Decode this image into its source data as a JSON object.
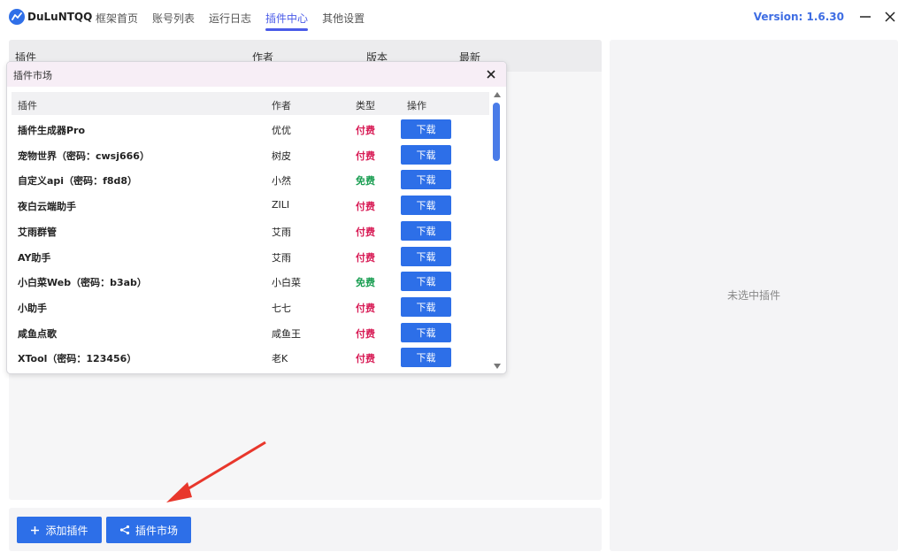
{
  "colors": {
    "accent": "#2d6fe8",
    "active_tab": "#4a5be8",
    "paid": "#d81b55",
    "free": "#1a9e52",
    "annotation_arrow": "#e8372c"
  },
  "app": {
    "name": "DuLuNTQQ",
    "version": "Version: 1.6.30"
  },
  "nav": {
    "tabs": [
      {
        "label": "框架首页",
        "active": false
      },
      {
        "label": "账号列表",
        "active": false
      },
      {
        "label": "运行日志",
        "active": false
      },
      {
        "label": "插件中心",
        "active": true
      },
      {
        "label": "其他设置",
        "active": false
      }
    ]
  },
  "plugin_table": {
    "headers": {
      "plugin": "插件",
      "author": "作者",
      "version": "版本",
      "latest": "最新"
    }
  },
  "side": {
    "empty_text": "未选中插件"
  },
  "bottom": {
    "add_label": "添加插件",
    "market_label": "插件市场"
  },
  "market": {
    "title": "插件市场",
    "headers": {
      "plugin": "插件",
      "author": "作者",
      "type": "类型",
      "action": "操作"
    },
    "download_label": "下载",
    "rows": [
      {
        "name": "插件生成器Pro",
        "author": "优优",
        "type": "付费",
        "paid": true
      },
      {
        "name": "宠物世界（密码：cwsj666）",
        "author": "树皮",
        "type": "付费",
        "paid": true
      },
      {
        "name": "自定义api（密码：f8d8）",
        "author": "小然",
        "type": "免费",
        "paid": false
      },
      {
        "name": "夜白云端助手",
        "author": "ZILI",
        "type": "付费",
        "paid": true
      },
      {
        "name": "艾雨群管",
        "author": "艾雨",
        "type": "付费",
        "paid": true
      },
      {
        "name": "AY助手",
        "author": "艾雨",
        "type": "付费",
        "paid": true
      },
      {
        "name": "小白菜Web（密码：b3ab）",
        "author": "小白菜",
        "type": "免费",
        "paid": false
      },
      {
        "name": "小助手",
        "author": "七七",
        "type": "付费",
        "paid": true
      },
      {
        "name": "咸鱼点歌",
        "author": "咸鱼王",
        "type": "付费",
        "paid": true
      },
      {
        "name": "XTool（密码：123456）",
        "author": "老K",
        "type": "付费",
        "paid": true
      }
    ]
  }
}
